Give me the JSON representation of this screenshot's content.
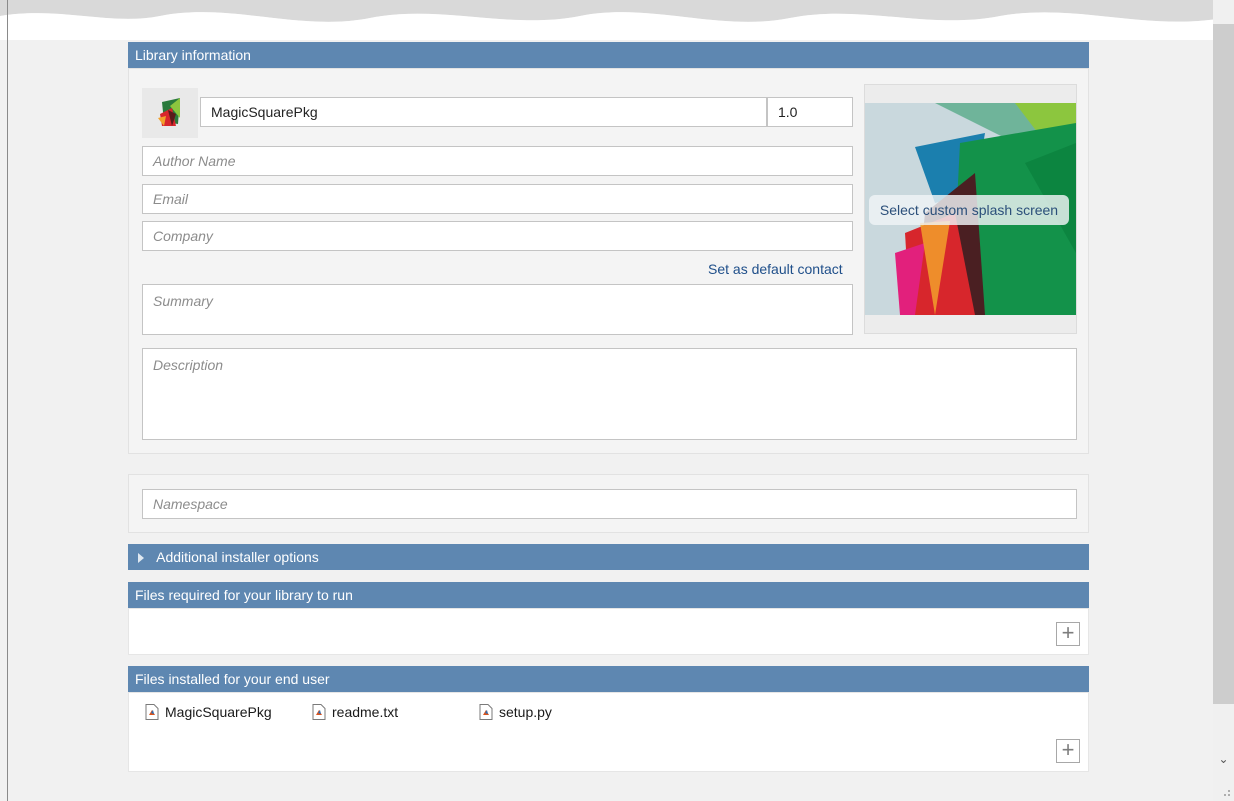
{
  "library_info": {
    "header": "Library information",
    "package_name": "MagicSquarePkg",
    "version": "1.0",
    "author_placeholder": "Author Name",
    "email_placeholder": "Email",
    "company_placeholder": "Company",
    "set_default_contact_link": "Set as default contact",
    "summary_placeholder": "Summary",
    "description_placeholder": "Description",
    "splash_button": "Select custom splash screen"
  },
  "namespace": {
    "placeholder": "Namespace"
  },
  "additional_options": {
    "header": "Additional installer options"
  },
  "files_required": {
    "header": "Files required for your library to run"
  },
  "files_installed": {
    "header": "Files installed for your end user",
    "files": [
      "MagicSquarePkg",
      "readme.txt",
      "setup.py"
    ]
  },
  "colors": {
    "section_header": "#5e87b1",
    "link": "#1f4f8a"
  }
}
